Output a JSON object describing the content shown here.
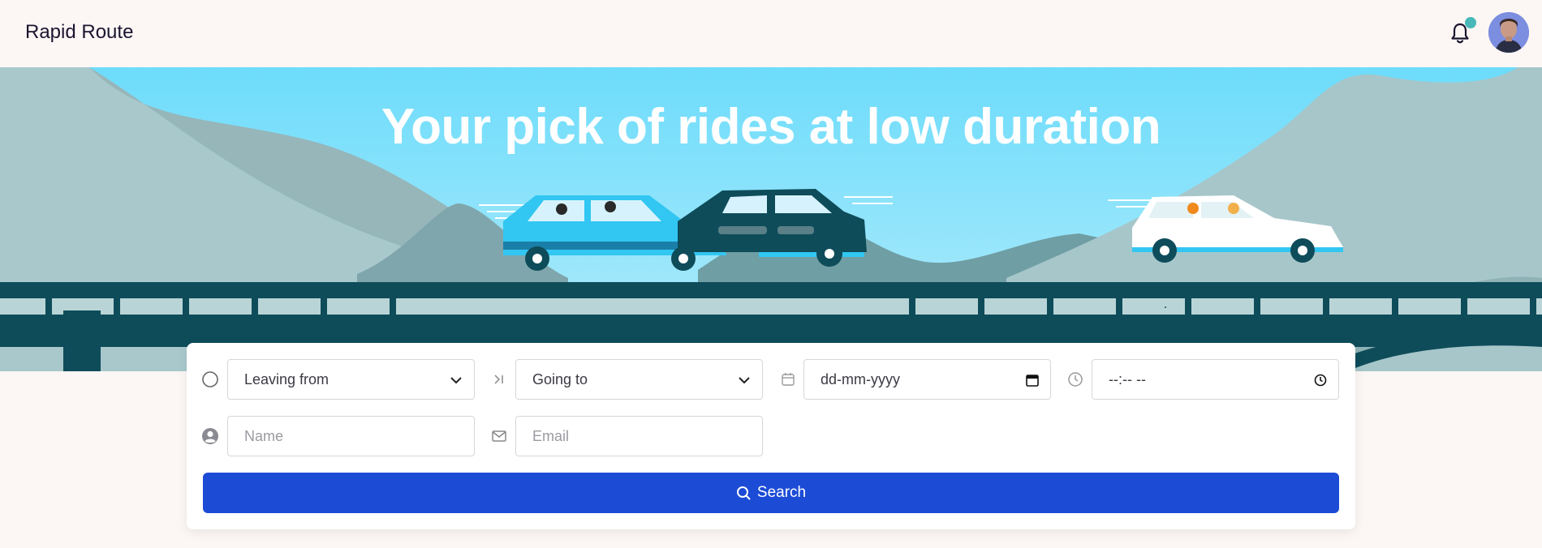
{
  "header": {
    "brand": "Rapid Route",
    "notification_icon": "bell-icon",
    "notification_dot_color": "#48b8b8",
    "avatar": "user-avatar"
  },
  "hero": {
    "title": "Your pick of rides at low duration"
  },
  "form": {
    "leaving_from": {
      "icon": "circle-icon",
      "value": "Leaving from"
    },
    "going_to": {
      "icon": "arrow-to-line-icon",
      "value": "Going to"
    },
    "date": {
      "icon": "calendar-icon",
      "value": "dd-mm-yyyy"
    },
    "time": {
      "icon": "clock-icon",
      "value": "--:-- --"
    },
    "name": {
      "icon": "user-circle-icon",
      "placeholder": "Name"
    },
    "email": {
      "icon": "mail-icon",
      "placeholder": "Email"
    },
    "search_label": "Search",
    "search_color": "#1c4bd6"
  }
}
